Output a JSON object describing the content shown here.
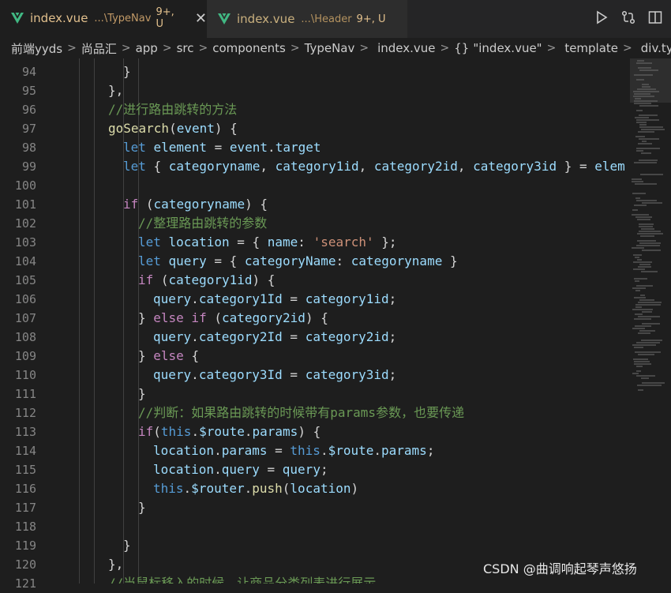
{
  "tabs": [
    {
      "name": "index.vue",
      "path": "...\\TypeNav",
      "status": "9+, U",
      "active": true
    },
    {
      "name": "index.vue",
      "path": "...\\Header",
      "status": "9+, U",
      "active": false
    }
  ],
  "close_glyph": "✕",
  "breadcrumb": [
    "前端yyds",
    "尚品汇",
    "app",
    "src",
    "components",
    "TypeNav",
    "index.vue",
    "\"index.vue\"",
    "template",
    "div.ty"
  ],
  "breadcrumb_braces": "{}",
  "line_numbers": [
    "94",
    "95",
    "96",
    "97",
    "98",
    "99",
    "100",
    "101",
    "102",
    "103",
    "104",
    "105",
    "106",
    "107",
    "108",
    "109",
    "110",
    "111",
    "112",
    "113",
    "114",
    "115",
    "116",
    "117",
    "118",
    "119",
    "120",
    "121"
  ],
  "code_lines": [
    {
      "indent": 1,
      "tokens": [
        [
          "pun",
          "}"
        ]
      ]
    },
    {
      "indent": 0,
      "tokens": [
        [
          "pun",
          "},"
        ]
      ]
    },
    {
      "indent": 0,
      "tokens": [
        [
          "cmt",
          "//进行路由跳转的方法"
        ]
      ]
    },
    {
      "indent": 0,
      "tokens": [
        [
          "fn",
          "goSearch"
        ],
        [
          "pun",
          "("
        ],
        [
          "var",
          "event"
        ],
        [
          "pun",
          ") {"
        ]
      ]
    },
    {
      "indent": 1,
      "tokens": [
        [
          "kw",
          "let "
        ],
        [
          "var",
          "element"
        ],
        [
          "pun",
          " = "
        ],
        [
          "var",
          "event"
        ],
        [
          "pun",
          "."
        ],
        [
          "prop",
          "target"
        ]
      ]
    },
    {
      "indent": 1,
      "tokens": [
        [
          "kw",
          "let "
        ],
        [
          "pun",
          "{ "
        ],
        [
          "var",
          "categoryname"
        ],
        [
          "pun",
          ", "
        ],
        [
          "var",
          "category1id"
        ],
        [
          "pun",
          ", "
        ],
        [
          "var",
          "category2id"
        ],
        [
          "pun",
          ", "
        ],
        [
          "var",
          "category3id"
        ],
        [
          "pun",
          " } = "
        ],
        [
          "var",
          "elem"
        ]
      ]
    },
    {
      "indent": 0,
      "tokens": []
    },
    {
      "indent": 1,
      "tokens": [
        [
          "ctl",
          "if "
        ],
        [
          "pun",
          "("
        ],
        [
          "var",
          "categoryname"
        ],
        [
          "pun",
          ") {"
        ]
      ]
    },
    {
      "indent": 2,
      "tokens": [
        [
          "cmt",
          "//整理路由跳转的参数"
        ]
      ]
    },
    {
      "indent": 2,
      "tokens": [
        [
          "kw",
          "let "
        ],
        [
          "var",
          "location"
        ],
        [
          "pun",
          " = { "
        ],
        [
          "prop",
          "name"
        ],
        [
          "pun",
          ": "
        ],
        [
          "str",
          "'search'"
        ],
        [
          "pun",
          " };"
        ]
      ]
    },
    {
      "indent": 2,
      "tokens": [
        [
          "kw",
          "let "
        ],
        [
          "var",
          "query"
        ],
        [
          "pun",
          " = { "
        ],
        [
          "prop",
          "categoryName"
        ],
        [
          "pun",
          ": "
        ],
        [
          "var",
          "categoryname"
        ],
        [
          "pun",
          " }"
        ]
      ]
    },
    {
      "indent": 2,
      "tokens": [
        [
          "ctl",
          "if "
        ],
        [
          "pun",
          "("
        ],
        [
          "var",
          "category1id"
        ],
        [
          "pun",
          ") {"
        ]
      ]
    },
    {
      "indent": 3,
      "tokens": [
        [
          "var",
          "query"
        ],
        [
          "pun",
          "."
        ],
        [
          "prop",
          "category1Id"
        ],
        [
          "pun",
          " = "
        ],
        [
          "var",
          "category1id"
        ],
        [
          "pun",
          ";"
        ]
      ]
    },
    {
      "indent": 2,
      "tokens": [
        [
          "pun",
          "} "
        ],
        [
          "ctl",
          "else if "
        ],
        [
          "pun",
          "("
        ],
        [
          "var",
          "category2id"
        ],
        [
          "pun",
          ") {"
        ]
      ]
    },
    {
      "indent": 3,
      "tokens": [
        [
          "var",
          "query"
        ],
        [
          "pun",
          "."
        ],
        [
          "prop",
          "category2Id"
        ],
        [
          "pun",
          " = "
        ],
        [
          "var",
          "category2id"
        ],
        [
          "pun",
          ";"
        ]
      ]
    },
    {
      "indent": 2,
      "tokens": [
        [
          "pun",
          "} "
        ],
        [
          "ctl",
          "else "
        ],
        [
          "pun",
          "{"
        ]
      ]
    },
    {
      "indent": 3,
      "tokens": [
        [
          "var",
          "query"
        ],
        [
          "pun",
          "."
        ],
        [
          "prop",
          "category3Id"
        ],
        [
          "pun",
          " = "
        ],
        [
          "var",
          "category3id"
        ],
        [
          "pun",
          ";"
        ]
      ]
    },
    {
      "indent": 2,
      "tokens": [
        [
          "pun",
          "}"
        ]
      ]
    },
    {
      "indent": 2,
      "tokens": [
        [
          "cmt",
          "//判断：如果路由跳转的时候带有params参数，也要传递"
        ]
      ]
    },
    {
      "indent": 2,
      "tokens": [
        [
          "ctl",
          "if"
        ],
        [
          "pun",
          "("
        ],
        [
          "kw",
          "this"
        ],
        [
          "pun",
          "."
        ],
        [
          "var",
          "$route"
        ],
        [
          "pun",
          "."
        ],
        [
          "prop",
          "params"
        ],
        [
          "pun",
          ") {"
        ]
      ]
    },
    {
      "indent": 3,
      "tokens": [
        [
          "var",
          "location"
        ],
        [
          "pun",
          "."
        ],
        [
          "prop",
          "params"
        ],
        [
          "pun",
          " = "
        ],
        [
          "kw",
          "this"
        ],
        [
          "pun",
          "."
        ],
        [
          "var",
          "$route"
        ],
        [
          "pun",
          "."
        ],
        [
          "prop",
          "params"
        ],
        [
          "pun",
          ";"
        ]
      ]
    },
    {
      "indent": 3,
      "tokens": [
        [
          "var",
          "location"
        ],
        [
          "pun",
          "."
        ],
        [
          "prop",
          "query"
        ],
        [
          "pun",
          " = "
        ],
        [
          "var",
          "query"
        ],
        [
          "pun",
          ";"
        ]
      ]
    },
    {
      "indent": 3,
      "tokens": [
        [
          "kw",
          "this"
        ],
        [
          "pun",
          "."
        ],
        [
          "var",
          "$router"
        ],
        [
          "pun",
          "."
        ],
        [
          "fn",
          "push"
        ],
        [
          "pun",
          "("
        ],
        [
          "var",
          "location"
        ],
        [
          "pun",
          ")"
        ]
      ]
    },
    {
      "indent": 2,
      "tokens": [
        [
          "pun",
          "}"
        ]
      ]
    },
    {
      "indent": 0,
      "tokens": []
    },
    {
      "indent": 1,
      "tokens": [
        [
          "pun",
          "}"
        ]
      ]
    },
    {
      "indent": 0,
      "tokens": [
        [
          "pun",
          "},"
        ]
      ]
    },
    {
      "indent": 0,
      "tokens": [
        [
          "cmt",
          "//当鼠标移入的时候，让商品分类列表进行展示"
        ]
      ]
    }
  ],
  "watermark": "CSDN @曲调响起琴声悠扬",
  "colors": {
    "vue_green": "#41b883",
    "modified": "#e2c08d",
    "background": "#1e1e1e"
  }
}
